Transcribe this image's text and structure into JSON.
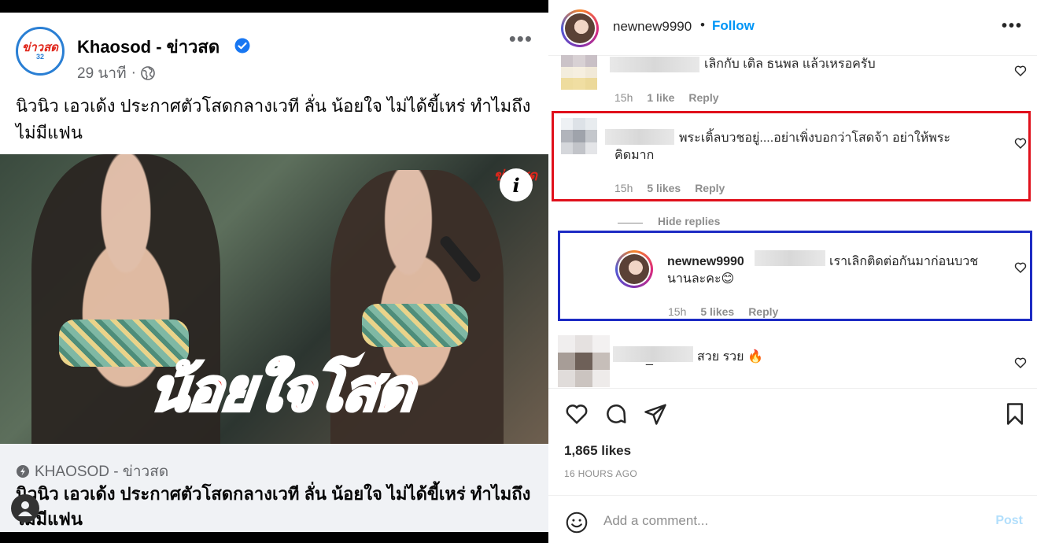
{
  "facebook": {
    "page_name": "Khaosod - ข่าวสด",
    "logo_text": "ข่าวสด",
    "logo_sub": "32",
    "time": "29 นาที",
    "caption": "นิวนิว เอวเด้ง ประกาศตัวโสดกลางเวที ลั่น น้อยใจ ไม่ได้ขี้เหร่ ทำไมถึงไม่มีแฟน",
    "image_overlay_text": "น้อยใจโสด",
    "image_watermark": "ข่าวสด",
    "image_info_label": "i",
    "link_domain": "KHAOSOD - ข่าวสด",
    "link_title": "นิวนิว เอวเด้ง ประกาศตัวโสดกลางเวที ลั่น น้อยใจ ไม่ได้ขี้เหร่ ทำไมถึงไม่มีแฟน"
  },
  "instagram": {
    "username": "newnew9990",
    "dot": "•",
    "follow_label": "Follow",
    "comments": [
      {
        "text": "เลิกกับ เติล ธนพล แล้วเหรอครับ",
        "time": "15h",
        "likes": "1 like",
        "reply": "Reply"
      },
      {
        "text": "พระเติ้ลบวชอยู่....อย่าเพิ่งบอกว่าโสดจ้า อย่าให้พระคิดมาก",
        "time": "15h",
        "likes": "5 likes",
        "reply": "Reply"
      },
      {
        "username": "newnew9990",
        "text": "เราเลิกติดต่อกันมาก่อนบวชนานละคะ😊",
        "time": "15h",
        "likes": "5 likes",
        "reply": "Reply"
      },
      {
        "separator": "_",
        "text": "สวย รวย 🔥"
      }
    ],
    "hide_replies": "Hide replies",
    "likes_count": "1,865 likes",
    "post_date": "16 HOURS AGO",
    "add_comment_placeholder": "Add a comment...",
    "post_label": "Post",
    "highlight_colors": {
      "red": "#e0101b",
      "blue": "#1d2bc4"
    },
    "accent_color": "#0095f6"
  }
}
